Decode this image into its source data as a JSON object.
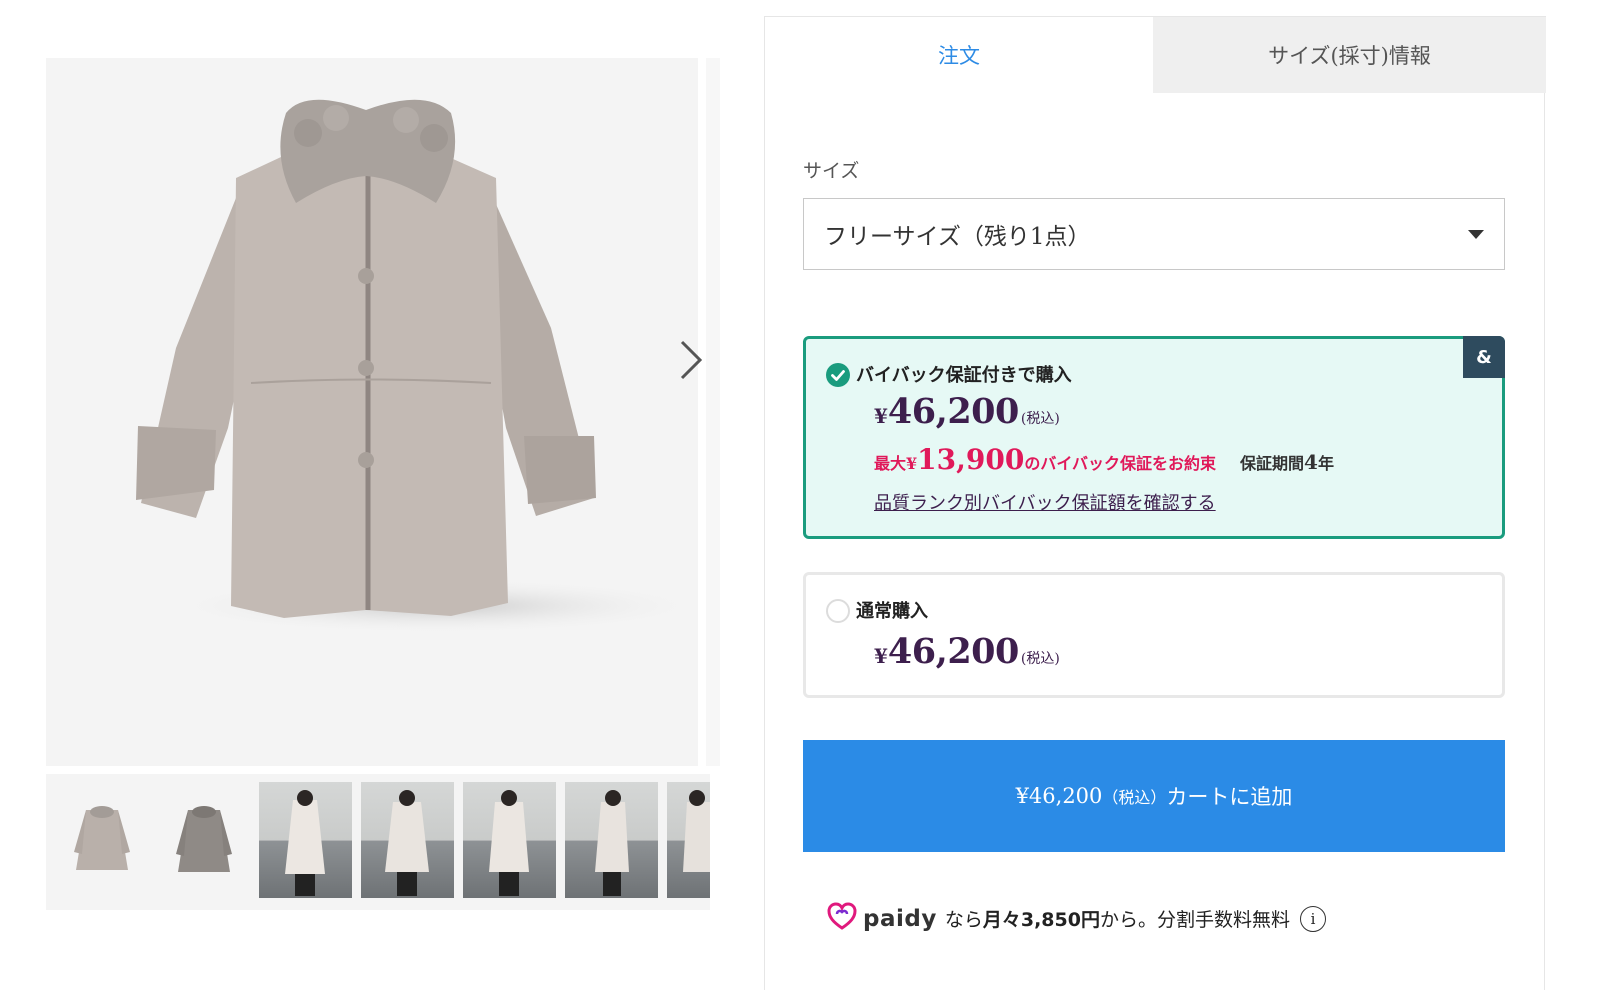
{
  "tabs": [
    {
      "label": "注文",
      "active": true
    },
    {
      "label": "サイズ(採寸)情報",
      "active": false
    }
  ],
  "size": {
    "label": "サイズ",
    "selected": "フリーサイズ（残り1点）"
  },
  "buyback_option": {
    "title": "バイバック保証付きで購入",
    "price_symbol": "¥",
    "price": "46,200",
    "tax_note": "(税込)",
    "promo_prefix": "最大¥",
    "promo_amount": "13,900",
    "promo_suffix": "のバイバック保証をお約束",
    "period_label": "保証期間",
    "period_value": "4",
    "period_unit": "年",
    "link": "品質ランク別バイバック保証額を確認する",
    "badge": "&",
    "selected": true
  },
  "normal_option": {
    "title": "通常購入",
    "price_symbol": "¥",
    "price": "46,200",
    "tax_note": "(税込)",
    "selected": false
  },
  "cart_button": {
    "price": "¥46,200",
    "tax_note": "（税込）",
    "label": "カートに追加"
  },
  "paidy": {
    "logo": "paidy",
    "text_pre": "なら",
    "monthly": "月々3,850円",
    "text_post": "から。分割手数料無料",
    "info": "i"
  },
  "colors": {
    "accent_blue": "#2b8be6",
    "buyback_green": "#1a9c7e",
    "price_purple": "#3d1f4d",
    "promo_red": "#e0195a"
  },
  "icons": [
    "chevron-right-icon",
    "check-icon",
    "caret-down-icon",
    "paidy-icon",
    "info-icon"
  ]
}
